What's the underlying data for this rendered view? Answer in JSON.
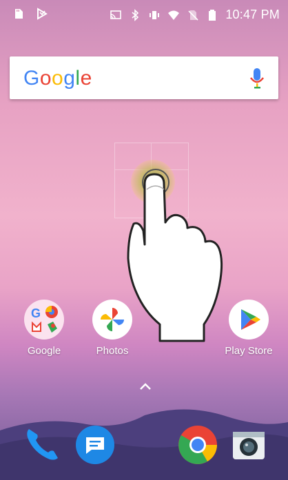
{
  "status_bar": {
    "time": "10:47 PM",
    "icons": [
      "sd-card-icon",
      "play-protect-icon",
      "cast-icon",
      "bluetooth-icon",
      "vibrate-icon",
      "wifi-icon",
      "no-sim-icon",
      "battery-icon"
    ]
  },
  "search_bar": {
    "logo_text": "Google",
    "mic_icon": "microphone-icon"
  },
  "apps": [
    {
      "label": "Google"
    },
    {
      "label": "Photos"
    },
    {
      "label": "Play Store"
    }
  ],
  "app_drawer_icon": "chevron-up-icon",
  "dock": [
    "phone-icon",
    "messages-icon",
    "chrome-icon",
    "camera-icon"
  ],
  "colors": {
    "google_blue": "#4285F4",
    "google_red": "#EA4335",
    "google_yellow": "#FBBC05",
    "google_green": "#34A853"
  }
}
